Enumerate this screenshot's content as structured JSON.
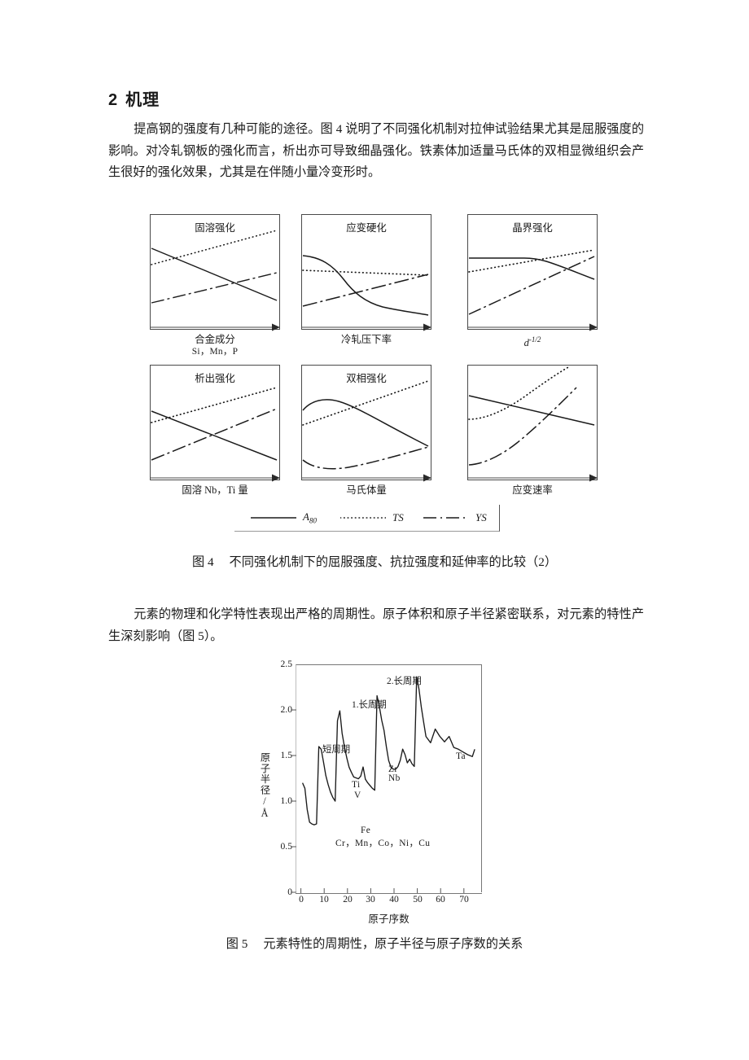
{
  "section": {
    "number": "2",
    "title": "机理"
  },
  "paragraphs": {
    "p1": "提高钢的强度有几种可能的途径。图 4 说明了不同强化机制对拉伸试验结果尤其是屈服强度的影响。对冷轧钢板的强化而言，析出亦可导致细晶强化。铁素体加适量马氏体的双相显微组织会产生很好的强化效果，尤其是在伴随小量冷变形时。",
    "p2": "元素的物理和化学特性表现出严格的周期性。原子体积和原子半径紧密联系，对元素的特性产生深刻影响（图 5）。"
  },
  "captions": {
    "fig4": "图 4",
    "fig4_text": "不同强化机制下的屈服强度、抗拉强度和延伸率的比较（2）",
    "fig5": "图 5",
    "fig5_text": "元素特性的周期性，原子半径与原子序数的关系"
  },
  "figure4": {
    "legend": [
      {
        "label": "A",
        "sub": "80",
        "style": "solid"
      },
      {
        "label": "TS",
        "sub": "",
        "style": "dotted"
      },
      {
        "label": "YS",
        "sub": "",
        "style": "dashdot"
      }
    ],
    "panels": [
      {
        "title": "固溶强化",
        "xlabel": "合金成分",
        "xlabel2": "Si，Mn，P"
      },
      {
        "title": "应变硬化",
        "xlabel": "冷轧压下率",
        "xlabel2": ""
      },
      {
        "title": "晶界强化",
        "xlabel": "d",
        "xlabel2": ""
      },
      {
        "title": "析出强化",
        "xlabel": "固溶 Nb，Ti 量",
        "xlabel2": ""
      },
      {
        "title": "双相强化",
        "xlabel": "马氏体量",
        "xlabel2": ""
      },
      {
        "title": "",
        "xlabel": "应变速率",
        "xlabel2": ""
      }
    ],
    "panel3_xlabel_exponent": "-1/2"
  },
  "chart_data": [
    {
      "type": "line",
      "title": "固溶强化",
      "xlabel": "合金成分 Si，Mn，P",
      "ylabel": "",
      "grid": false,
      "legend_position": "below-figure",
      "xlim": [
        0,
        1
      ],
      "ylim": [
        0,
        1
      ],
      "series": [
        {
          "name": "A80",
          "style": "solid",
          "x": [
            0.0,
            1.0
          ],
          "y": [
            0.7,
            0.26
          ]
        },
        {
          "name": "TS",
          "style": "dotted",
          "x": [
            0.0,
            1.0
          ],
          "y": [
            0.56,
            0.86
          ]
        },
        {
          "name": "YS",
          "style": "dashdot",
          "x": [
            0.0,
            1.0
          ],
          "y": [
            0.23,
            0.49
          ]
        }
      ]
    },
    {
      "type": "line",
      "title": "应变硬化",
      "xlabel": "冷轧压下率",
      "ylabel": "",
      "grid": false,
      "xlim": [
        0,
        1
      ],
      "ylim": [
        0,
        1
      ],
      "series": [
        {
          "name": "A80",
          "style": "solid",
          "x": [
            0.0,
            0.18,
            0.34,
            0.46,
            0.58,
            0.72,
            1.0
          ],
          "y": [
            0.64,
            0.62,
            0.52,
            0.38,
            0.26,
            0.19,
            0.12
          ]
        },
        {
          "name": "TS",
          "style": "dotted",
          "x": [
            0.0,
            1.0
          ],
          "y": [
            0.51,
            0.47
          ]
        },
        {
          "name": "YS",
          "style": "dashdot",
          "x": [
            0.0,
            1.0
          ],
          "y": [
            0.2,
            0.48
          ]
        }
      ]
    },
    {
      "type": "line",
      "title": "晶界强化",
      "xlabel": "d^-1/2",
      "ylabel": "",
      "grid": false,
      "xlim": [
        0,
        1
      ],
      "ylim": [
        0,
        1
      ],
      "series": [
        {
          "name": "A80",
          "style": "solid",
          "x": [
            0.0,
            0.45,
            0.68,
            1.0
          ],
          "y": [
            0.62,
            0.62,
            0.58,
            0.44
          ]
        },
        {
          "name": "TS",
          "style": "dotted",
          "x": [
            0.0,
            1.0
          ],
          "y": [
            0.5,
            0.69
          ]
        },
        {
          "name": "YS",
          "style": "dashdot",
          "x": [
            0.0,
            1.0
          ],
          "y": [
            0.13,
            0.63
          ]
        }
      ]
    },
    {
      "type": "line",
      "title": "析出强化",
      "xlabel": "固溶 Nb，Ti 量",
      "ylabel": "",
      "grid": false,
      "xlim": [
        0,
        1
      ],
      "ylim": [
        0,
        1
      ],
      "series": [
        {
          "name": "A80",
          "style": "solid",
          "x": [
            0.0,
            1.0
          ],
          "y": [
            0.6,
            0.18
          ]
        },
        {
          "name": "TS",
          "style": "dotted",
          "x": [
            0.0,
            1.0
          ],
          "y": [
            0.5,
            0.81
          ]
        },
        {
          "name": "YS",
          "style": "dashdot",
          "x": [
            0.0,
            1.0
          ],
          "y": [
            0.18,
            0.62
          ]
        }
      ]
    },
    {
      "type": "line",
      "title": "双相强化",
      "xlabel": "马氏体量",
      "ylabel": "",
      "grid": false,
      "xlim": [
        0,
        1
      ],
      "ylim": [
        0,
        1
      ],
      "series": [
        {
          "name": "A80",
          "style": "solid",
          "x": [
            0.0,
            0.12,
            0.26,
            0.42,
            0.62,
            0.82,
            1.0
          ],
          "y": [
            0.61,
            0.67,
            0.68,
            0.61,
            0.5,
            0.38,
            0.3
          ]
        },
        {
          "name": "TS",
          "style": "dotted",
          "x": [
            0.0,
            1.0
          ],
          "y": [
            0.48,
            0.86
          ]
        },
        {
          "name": "YS",
          "style": "dashdot",
          "x": [
            0.0,
            0.14,
            0.3,
            0.52,
            0.78,
            1.0
          ],
          "y": [
            0.18,
            0.1,
            0.09,
            0.14,
            0.21,
            0.26
          ]
        }
      ]
    },
    {
      "type": "line",
      "title": "",
      "xlabel": "应变速率",
      "ylabel": "",
      "grid": false,
      "xlim": [
        0,
        1
      ],
      "ylim": [
        0,
        1
      ],
      "series": [
        {
          "name": "A80",
          "style": "solid",
          "x": [
            0.0,
            1.0
          ],
          "y": [
            0.72,
            0.47
          ]
        },
        {
          "name": "TS",
          "style": "dotted",
          "x": [
            0.0,
            0.14,
            0.32,
            0.52,
            0.72,
            0.88
          ],
          "y": [
            0.52,
            0.52,
            0.58,
            0.7,
            0.86,
            0.97
          ]
        },
        {
          "name": "YS",
          "style": "dashdot",
          "x": [
            0.0,
            0.12,
            0.3,
            0.5,
            0.7,
            0.88
          ],
          "y": [
            0.12,
            0.13,
            0.21,
            0.36,
            0.56,
            0.8
          ]
        }
      ]
    },
    {
      "type": "line",
      "title": "",
      "xlabel": "原子序数",
      "ylabel": "原子半径/Å",
      "grid": false,
      "xlim": [
        0,
        80
      ],
      "ylim": [
        0,
        2.5
      ],
      "yticks": [
        0,
        0.5,
        1.0,
        1.5,
        2.0,
        2.5
      ],
      "ytick_labels": [
        "0",
        "0.5",
        "1.0",
        "1.5",
        "2.0",
        "2.5"
      ],
      "xticks": [
        0,
        10,
        20,
        30,
        40,
        50,
        60,
        70
      ],
      "xtick_labels": [
        "0",
        "10",
        "20",
        "30",
        "40",
        "50",
        "60",
        "70"
      ],
      "annotations": [
        {
          "text": "短周期",
          "x": 11,
          "y": 1.72
        },
        {
          "text": "1.长周期",
          "x": 24,
          "y": 2.05
        },
        {
          "text": "2.长周期",
          "x": 48,
          "y": 2.3
        },
        {
          "text": "Ti",
          "x": 25,
          "y": 1.24
        },
        {
          "text": "V",
          "x": 26,
          "y": 1.15
        },
        {
          "text": "Zr",
          "x": 41,
          "y": 1.4
        },
        {
          "text": "Nb",
          "x": 42,
          "y": 1.3
        },
        {
          "text": "Ta",
          "x": 70,
          "y": 1.54
        },
        {
          "text": "Fe",
          "x": 30,
          "y": 0.84
        },
        {
          "text": "Cr，Mn，Co，Ni，Cu",
          "x": 33,
          "y": 0.74
        }
      ],
      "x": [
        3,
        4,
        5,
        6,
        7,
        8,
        9,
        10,
        11,
        12,
        13,
        14,
        15,
        16,
        17,
        18,
        19,
        20,
        21,
        22,
        23,
        24,
        25,
        26,
        27,
        28,
        29,
        30,
        31,
        32,
        33,
        34,
        35,
        36,
        37,
        38,
        39,
        40,
        41,
        42,
        43,
        44,
        45,
        46,
        47,
        48,
        49,
        50,
        51,
        52,
        53,
        54,
        55,
        56,
        57,
        58,
        60,
        62,
        64,
        66,
        68,
        70,
        72,
        74,
        76,
        78,
        79
      ],
      "y": [
        1.2,
        1.14,
        0.91,
        0.77,
        0.75,
        0.74,
        0.75,
        1.6,
        1.57,
        1.42,
        1.28,
        1.18,
        1.1,
        1.04,
        1.0,
        1.88,
        2.02,
        1.74,
        1.62,
        1.47,
        1.35,
        1.29,
        1.27,
        1.26,
        1.25,
        1.24,
        1.28,
        1.38,
        1.26,
        1.22,
        1.19,
        1.16,
        1.14,
        2.18,
        2.06,
        1.91,
        1.8,
        1.6,
        1.45,
        1.43,
        1.36,
        1.34,
        1.34,
        1.37,
        1.44,
        1.56,
        1.5,
        1.41,
        1.45,
        1.4,
        1.37,
        2.38,
        2.25,
        2.04,
        1.88,
        1.72,
        1.65,
        1.8,
        1.72,
        1.66,
        1.72,
        1.6,
        1.58,
        1.55,
        1.52,
        1.5,
        1.58
      ]
    }
  ]
}
